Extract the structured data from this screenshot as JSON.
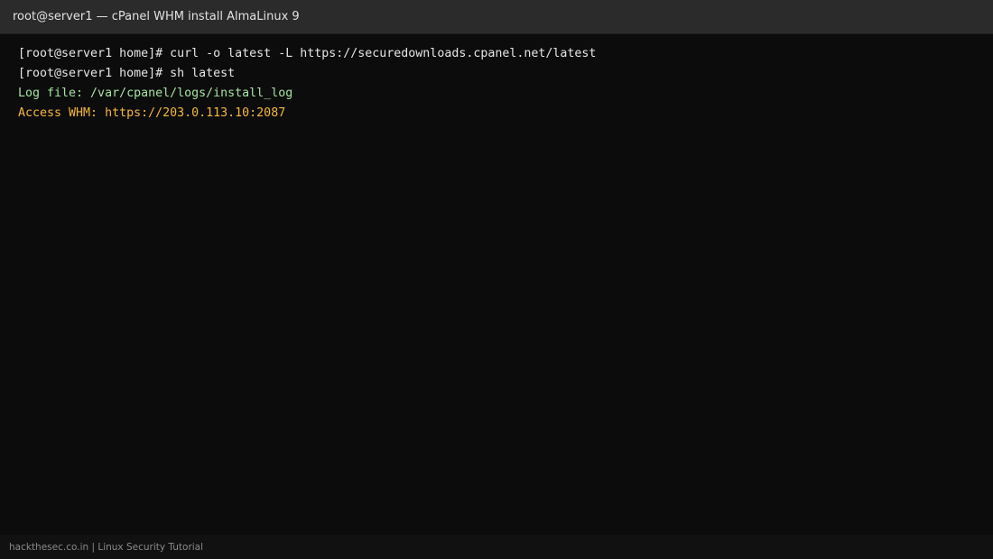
{
  "window": {
    "title": "root@server1 — cPanel WHM install AlmaLinux 9"
  },
  "terminal": {
    "lines": [
      {
        "text": "[root@server1 home]# curl -o latest -L https://securedownloads.cpanel.net/latest",
        "color": "#e6e6e6"
      },
      {
        "text": "[root@server1 home]# sh latest",
        "color": "#e6e6e6"
      },
      {
        "text": "Log file: /var/cpanel/logs/install_log",
        "color": "#a6e3a1"
      },
      {
        "text": "Access WHM: https://203.0.113.10:2087",
        "color": "#f5b83d"
      }
    ]
  },
  "footer": {
    "text": "hackthesec.co.in | Linux Security Tutorial"
  },
  "colors": {
    "titlebar_bg": "#2b2b2b",
    "terminal_bg": "#0c0c0c",
    "footer_bg": "#111111",
    "default_text": "#e6e6e6",
    "info_text": "#a6e3a1",
    "highlight_text": "#f5b83d"
  }
}
